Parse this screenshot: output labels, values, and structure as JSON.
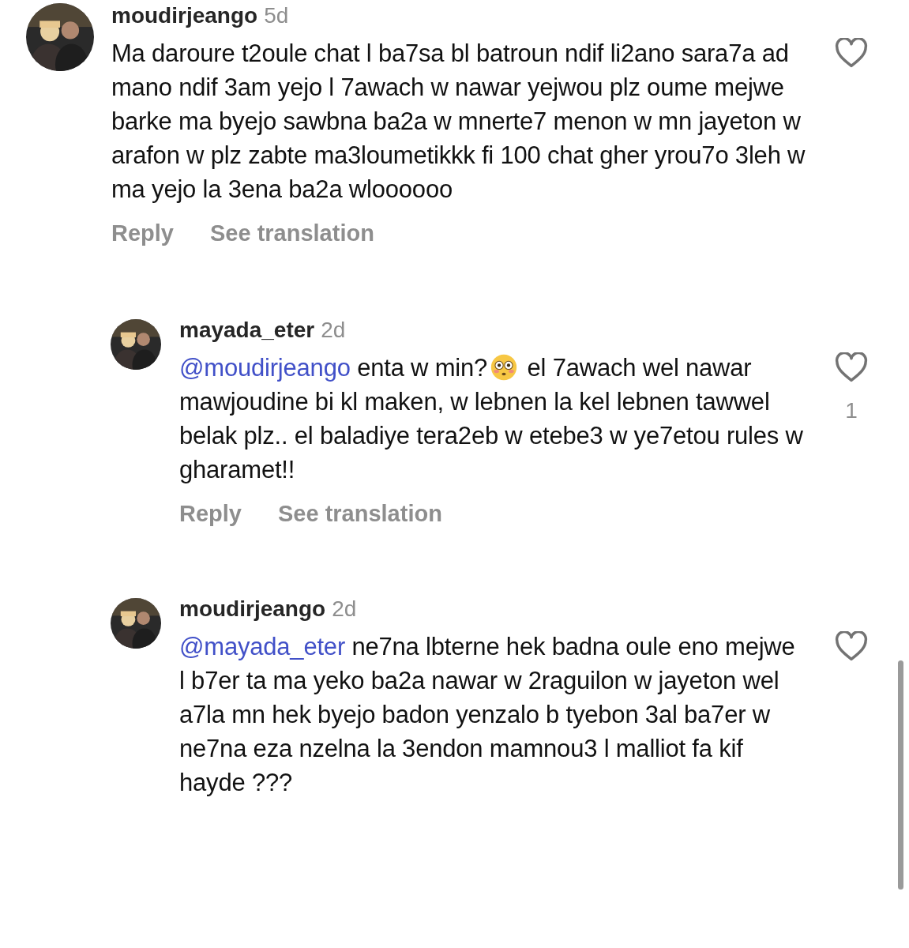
{
  "comments": [
    {
      "username": "moudirjeango",
      "time": "5d",
      "body": [
        {
          "kind": "text",
          "text": "Ma daroure t2oule chat l ba7sa bl batroun ndif li2ano sara7a ad mano ndif 3am yejo l 7awach w nawar yejwou plz oume mejwe barke ma byejo sawbna ba2a w mnerte7 menon w mn jayeton w arafon w  plz zabte ma3loumetikkk fi 100 chat gher yrou7o 3leh w ma yejo la 3ena ba2a wloooooo"
        }
      ],
      "reply": "Reply",
      "translate": "See translation",
      "liked": false,
      "children": [
        {
          "username": "mayada_eter",
          "time": "2d",
          "body": [
            {
              "kind": "mention",
              "text": "@moudirjeango"
            },
            {
              "kind": "text",
              "text": " enta w min?"
            },
            {
              "kind": "emoji"
            },
            {
              "kind": "text",
              "text": " el 7awach wel nawar mawjoudine bi kl maken, w lebnen la kel lebnen tawwel belak plz.. el baladiye tera2eb w etebe3 w ye7etou rules w gharamet!!"
            }
          ],
          "reply": "Reply",
          "translate": "See translation",
          "liked": false,
          "likes": "1"
        },
        {
          "username": "moudirjeango",
          "time": "2d",
          "body": [
            {
              "kind": "mention",
              "text": "@mayada_eter"
            },
            {
              "kind": "text",
              "text": " ne7na lbterne hek badna oule eno mejwe l b7er ta ma yeko ba2a nawar w 2raguilon w jayeton wel a7la mn hek byejo badon yenzalo b tyebon 3al ba7er w ne7na eza nzelna la 3endon mamnou3 l malliot fa kif hayde ???"
            }
          ],
          "liked": false
        }
      ]
    }
  ]
}
